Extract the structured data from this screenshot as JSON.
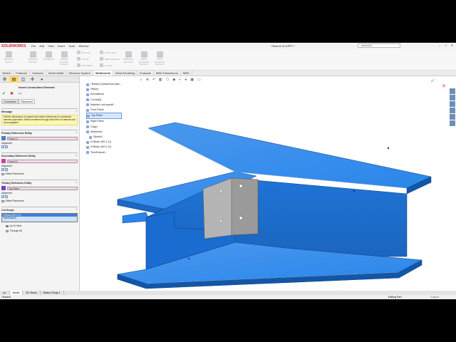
{
  "app": {
    "logo": "SOLIDWORKS",
    "menu": [
      "File",
      "Edit",
      "View",
      "Insert",
      "Tools",
      "Window"
    ],
    "doc_title": "I Beams.SLDPRT *",
    "search_placeholder": "partname"
  },
  "ribbon": {
    "big_buttons": [
      "Structural Search",
      "Structural Member",
      "Trim/Extend",
      "Rebuild Structure System",
      "Weldment",
      "End Caps",
      "Gussets",
      "Reference Geometry",
      "Define Connection Element",
      "Insert Connection Element"
    ],
    "small_buttons": [
      "End Cap",
      "Gusset",
      "Weld Bead",
      "Cut list Item",
      "Make Weldment",
      "Cut List"
    ]
  },
  "cmd_tabs": [
    "Sketch",
    "Features",
    "Surfaces",
    "Sheet Metal",
    "Structure System",
    "Weldments",
    "Mesh Modeling",
    "Evaluate",
    "MBD Dimensions",
    "MBD"
  ],
  "active_cmd_tab": "Weldments",
  "panel": {
    "title": "Insert Connection Element",
    "subtabs": [
      "Connection",
      "Placement"
    ],
    "message_header": "Message",
    "message": "Edit the dimensions if required and select references for connection element placement. Select members through which the cut features will be propagated.",
    "primary_header": "Primary Reference Entity",
    "primary_value": "Face<1>",
    "secondary_header": "Secondary Reference Entity",
    "secondary_value": "Face<2>",
    "tertiary_header": "Tertiary Reference Entity",
    "tertiary_value": "Top Plane",
    "alignment_label": "Alignment",
    "offset_label": "Offset Placement",
    "cut_scope_header": "Cut Scope",
    "cut_scope_items": [
      "I/I Beam-WO.2 (1)",
      "Trim/Extend1"
    ],
    "radio_up_to_next": "Up To Next",
    "radio_through_all": "Through All"
  },
  "tree": {
    "items": [
      "I Beams (Default<As Mac...",
      "History",
      "Annotations",
      "Cut list(3)",
      "Material <not specifi...",
      "Front Plane",
      "Top Plane",
      "Right Plane",
      "Origin",
      "Weldment",
      "Sketch1",
      "I/I Beam-WO.2 (1)",
      "I/I Beam-WO.2 (1)",
      "Trim/Extend1"
    ]
  },
  "bottom_tabs": [
    "Model",
    "3D Views",
    "Motion Study 1"
  ],
  "status": {
    "left": "I Beams",
    "right": "Editing Part",
    "units": "Custom"
  },
  "colors": {
    "beam": "#1f7ae0",
    "beam_dark": "#1256a8",
    "beam_light": "#4a98ee",
    "plate": "#a8a8a8",
    "accent": "#ffd966"
  }
}
